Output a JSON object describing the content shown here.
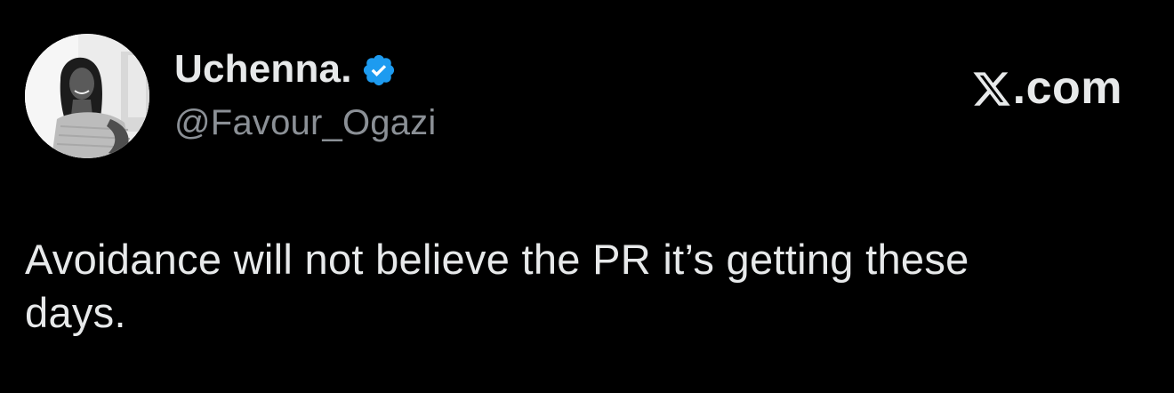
{
  "author": {
    "display_name": "Uchenna.",
    "handle": "@Favour_Ogazi",
    "verified": true,
    "avatar_icon": "profile-photo"
  },
  "brand": {
    "logo_icon": "x-logo-icon",
    "text": ".com"
  },
  "tweet": {
    "text": "Avoidance will not believe the PR it’s getting these\ndays."
  },
  "colors": {
    "background": "#000000",
    "text_primary": "#e7e9ea",
    "text_secondary": "#8b9096",
    "verified_blue": "#1d9bf0"
  }
}
